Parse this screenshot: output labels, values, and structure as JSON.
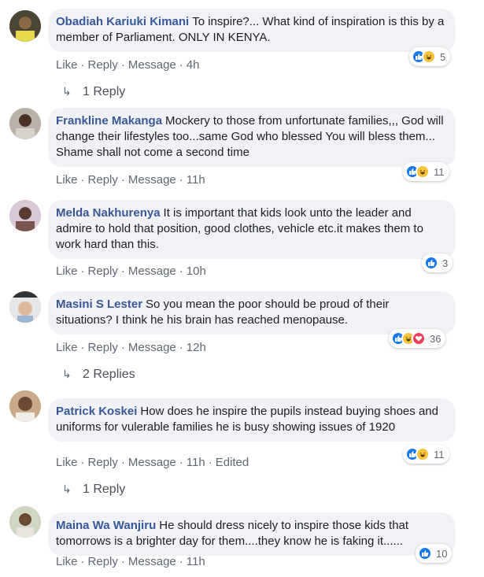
{
  "comments": [
    {
      "author": "Obadiah Kariuki Kimani",
      "text": "To inspire?... What kind of inspiration is this by a member of Parliament. ONLY IN KENYA.",
      "actions": {
        "like": "Like",
        "reply": "Reply",
        "message": "Message",
        "time": "4h"
      },
      "reaction_count": "5",
      "reaction_icons": [
        "like-icon",
        "haha-icon"
      ],
      "replies_label": "1 Reply"
    },
    {
      "author": "Frankline Makanga",
      "text": "Mockery to those from unfortunate families,,, God will change their lifestyles too...same God who blessed You will bless them... Shame shall not come a second time",
      "actions": {
        "like": "Like",
        "reply": "Reply",
        "message": "Message",
        "time": "11h"
      },
      "reaction_count": "11",
      "reaction_icons": [
        "like-icon",
        "haha-icon"
      ]
    },
    {
      "author": "Melda Nakhurenya",
      "text": "It is important that kids look unto the leader and admire to hold that position, good clothes, vehicle etc.it makes them to work hard than this.",
      "actions": {
        "like": "Like",
        "reply": "Reply",
        "message": "Message",
        "time": "10h"
      },
      "reaction_count": "3",
      "reaction_icons": [
        "like-icon"
      ]
    },
    {
      "author": "Masini S Lester",
      "text": "So you mean the poor should be proud of their situations? I think he his brain has reached menopause.",
      "actions": {
        "like": "Like",
        "reply": "Reply",
        "message": "Message",
        "time": "12h"
      },
      "reaction_count": "36",
      "reaction_icons": [
        "like-icon",
        "haha-icon",
        "love-icon"
      ],
      "replies_label": "2 Replies"
    },
    {
      "author": "Patrick Koskei",
      "text": "How does he inspire the pupils instead buying shoes and uniforms for vulerable families he is busy showing issues of 1920",
      "actions": {
        "like": "Like",
        "reply": "Reply",
        "message": "Message",
        "time": "11h",
        "edited": "Edited"
      },
      "reaction_count": "11",
      "reaction_icons": [
        "like-icon",
        "haha-icon"
      ],
      "replies_label": "1 Reply"
    },
    {
      "author": "Maina Wa Wanjiru",
      "text": "He should dress nicely to inspire those kids that tomorrows is a brighter day for them....they know he is faking it......",
      "actions": {
        "like": "Like",
        "reply": "Reply",
        "message": "Message",
        "time": "11h"
      },
      "reaction_count": "10",
      "reaction_icons": [
        "like-icon"
      ]
    }
  ],
  "colors": {
    "author": "#385898",
    "bubble": "#f0f2f5",
    "meta": "#606770",
    "like": "#1877f2",
    "haha": "#f7c33c",
    "love": "#f33e58"
  }
}
